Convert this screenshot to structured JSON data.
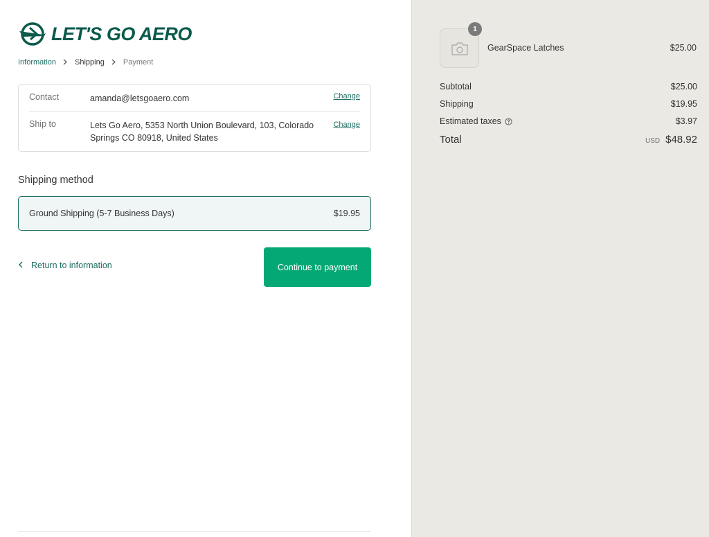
{
  "brand": {
    "name": "LET'S GO AERO",
    "color": "#0b5a4c"
  },
  "breadcrumb": {
    "information": "Information",
    "shipping": "Shipping",
    "payment": "Payment",
    "separator": "›"
  },
  "review": {
    "contact_label": "Contact",
    "contact_value": "amanda@letsgoaero.com",
    "ship_label": "Ship to",
    "ship_value": "Lets Go Aero, 5353 North Union Boulevard, 103, Colorado Springs CO 80918, United States",
    "change_label": "Change"
  },
  "shipping_method": {
    "title": "Shipping method",
    "option_name": "Ground Shipping (5-7 Business Days)",
    "option_price": "$19.95"
  },
  "actions": {
    "return_label": "Return to information",
    "continue_label": "Continue to payment",
    "accent": "#03a875"
  },
  "order": {
    "item": {
      "name": "GearSpace Latches",
      "price": "$25.00",
      "quantity": "1",
      "icon": "camera-icon"
    },
    "subtotal_label": "Subtotal",
    "subtotal_value": "$25.00",
    "shipping_label": "Shipping",
    "shipping_value": "$19.95",
    "taxes_label": "Estimated taxes",
    "taxes_value": "$3.97",
    "total_label": "Total",
    "currency": "USD",
    "total_value": "$48.92"
  }
}
